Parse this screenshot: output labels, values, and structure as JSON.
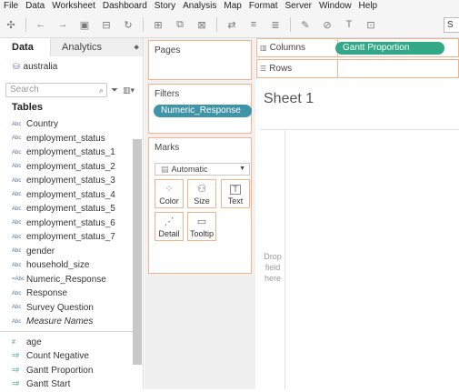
{
  "menu": [
    "File",
    "Data",
    "Worksheet",
    "Dashboard",
    "Story",
    "Analysis",
    "Map",
    "Format",
    "Server",
    "Window",
    "Help"
  ],
  "toolbar": {
    "icons": [
      "tableau-logo-icon",
      "undo-icon",
      "redo-icon",
      "save-icon",
      "new-datasource-icon",
      "refresh-icon",
      "new-sheet-icon",
      "duplicate-icon",
      "clear-icon",
      "swap-icon",
      "sort-asc-icon",
      "sort-desc-icon",
      "highlight-icon",
      "group-icon",
      "labels-icon",
      "fix-axes-icon"
    ],
    "search_value": "S"
  },
  "data_pane": {
    "tab_data": "Data",
    "tab_analytics": "Analytics",
    "datasource": "australia",
    "search_placeholder": "Search",
    "tables_heading": "Tables",
    "dimensions": [
      {
        "label": "Country",
        "icon": "Abc"
      },
      {
        "label": "employment_status",
        "icon": "Abc"
      },
      {
        "label": "employment_status_1",
        "icon": "Abc"
      },
      {
        "label": "employment_status_2",
        "icon": "Abc"
      },
      {
        "label": "employment_status_3",
        "icon": "Abc"
      },
      {
        "label": "employment_status_4",
        "icon": "Abc"
      },
      {
        "label": "employment_status_5",
        "icon": "Abc"
      },
      {
        "label": "employment_status_6",
        "icon": "Abc"
      },
      {
        "label": "employment_status_7",
        "icon": "Abc"
      },
      {
        "label": "gender",
        "icon": "Abc"
      },
      {
        "label": "household_size",
        "icon": "Abc"
      },
      {
        "label": "Numeric_Response",
        "icon": "=Abc"
      },
      {
        "label": "Response",
        "icon": "Abc"
      },
      {
        "label": "Survey Question",
        "icon": "Abc"
      },
      {
        "label": "Measure Names",
        "icon": "Abc"
      }
    ],
    "measures": [
      {
        "label": "age",
        "icon": "#"
      },
      {
        "label": "Count Negative",
        "icon": "=#"
      },
      {
        "label": "Gantt Proportion",
        "icon": "=#"
      },
      {
        "label": "Gantt Start",
        "icon": "=#"
      }
    ]
  },
  "pages_card": {
    "title": "Pages"
  },
  "filters_card": {
    "title": "Filters",
    "pill": "Numeric_Response"
  },
  "marks_card": {
    "title": "Marks",
    "mark_type": "Automatic",
    "buttons": [
      "Color",
      "Size",
      "Text",
      "Detail",
      "Tooltip"
    ]
  },
  "shelves": {
    "columns_label": "Columns",
    "columns_pill": "Gantt Proportion",
    "rows_label": "Rows"
  },
  "sheet": {
    "title": "Sheet 1",
    "drop_hint": [
      "Drop",
      "field",
      "here"
    ]
  },
  "colors": {
    "pill": "#3f94a8",
    "shelf_border": "#f2b28a",
    "measure_icon": "#2aa58a",
    "dimension_icon": "#4b72a8"
  }
}
